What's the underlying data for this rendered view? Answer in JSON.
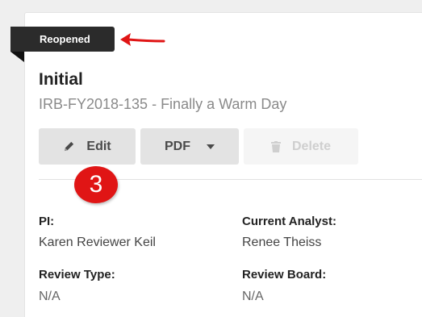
{
  "status": {
    "label": "Reopened"
  },
  "record": {
    "title": "Initial",
    "subtitle": "IRB-FY2018-135 - Finally a Warm Day"
  },
  "toolbar": {
    "edit_label": "Edit",
    "pdf_label": "PDF",
    "delete_label": "Delete"
  },
  "annotation": {
    "step_number": "3"
  },
  "details": {
    "pi_label": "PI:",
    "pi_value": "Karen Reviewer Keil",
    "analyst_label": "Current Analyst:",
    "analyst_value": "Renee Theiss",
    "review_type_label": "Review Type:",
    "review_type_value": "N/A",
    "review_board_label": "Review Board:",
    "review_board_value": "N/A"
  },
  "colors": {
    "accent_red": "#e01515",
    "ribbon": "#2b2b2b",
    "button_bg": "#e3e3e3"
  },
  "icons": {
    "edit": "pencil-icon",
    "pdf_menu": "caret-down-icon",
    "delete": "trash-icon",
    "annotation": "red-arrow-icon"
  }
}
